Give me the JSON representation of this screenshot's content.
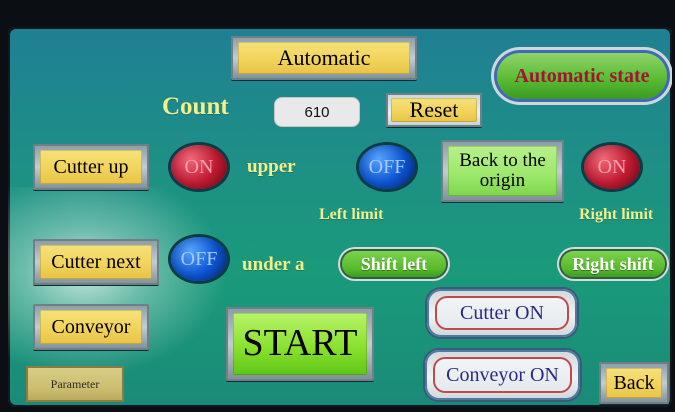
{
  "screen": {
    "top_title": "Automatic",
    "state_badge": "Automatic state",
    "count_label": "Count",
    "count_value": "610",
    "reset_button": "Reset",
    "buttons": {
      "cutter_up": "Cutter up",
      "cutter_next": "Cutter next",
      "conveyor": "Conveyor",
      "parameter": "Parameter",
      "back_to_origin": "Back to the origin",
      "start": "START",
      "back": "Back",
      "cutter_on": "Cutter ON",
      "conveyor_on": "Conveyor ON",
      "shift_left": "Shift left",
      "right_shift": "Right shift"
    },
    "indicators": {
      "upper_state": "ON",
      "under_state": "OFF",
      "left_limit_state": "OFF",
      "right_limit_state": "ON"
    },
    "labels": {
      "upper": "upper",
      "under_a": "under a",
      "left_limit": "Left limit",
      "right_limit": "Right limit"
    }
  }
}
